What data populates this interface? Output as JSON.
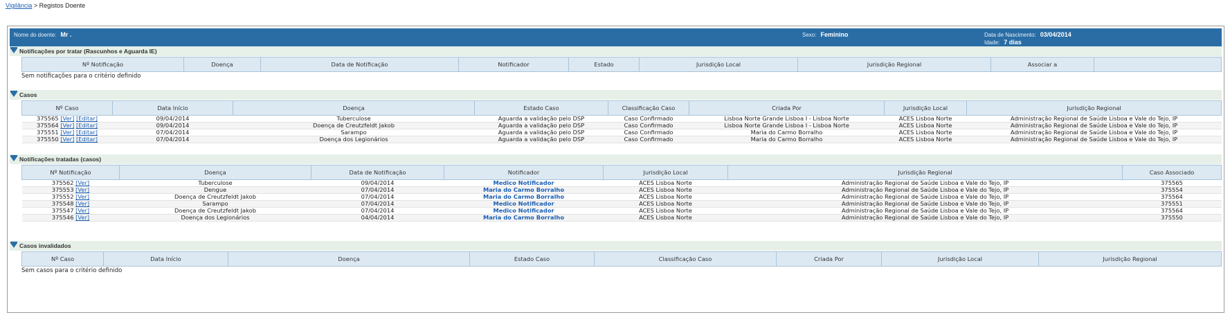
{
  "breadcrumb": {
    "link": "Vigilância",
    "sep": " > ",
    "current": "Registos Doente"
  },
  "patient": {
    "name_label": "Nome do doente:",
    "name": "Mr .",
    "sex_label": "Sexo:",
    "sex": "Feminino",
    "dob_label": "Data de Nascimento:",
    "dob": "03/04/2014",
    "age_label": "Idade:",
    "age": "7 dias"
  },
  "pending": {
    "title": "Notificações por tratar (Rascunhos e Aguarda IE)",
    "headers": [
      "Nº Notificação",
      "Doença",
      "Data de Notificação",
      "Notificador",
      "Estado",
      "Jurisdição Local",
      "Jurisdição Regional",
      "Associar a",
      ""
    ],
    "empty": "Sem notificações para o critério definido"
  },
  "cases": {
    "title": "Casos",
    "headers": [
      "Nº Caso",
      "Data Início",
      "Doença",
      "Estado Caso",
      "Classificação Caso",
      "Criada Por",
      "Jurisdição Local",
      "Jurisdição Regional"
    ],
    "ver": "[Ver]",
    "edit": "[Editar]",
    "rows": [
      [
        "375565",
        "09/04/2014",
        "Tuberculose",
        "Aguarda a validação pelo DSP",
        "Caso Confirmado",
        "Lisboa Norte Grande Lisboa I - Lisboa Norte",
        "ACES Lisboa Norte",
        "Administração Regional de Saúde Lisboa e Vale do Tejo, IP"
      ],
      [
        "375564",
        "09/04/2014",
        "Doença de Creutzfeldt Jakob",
        "Aguarda a validação pelo DSP",
        "Caso Confirmado",
        "Lisboa Norte Grande Lisboa I - Lisboa Norte",
        "ACES Lisboa Norte",
        "Administração Regional de Saúde Lisboa e Vale do Tejo, IP"
      ],
      [
        "375551",
        "07/04/2014",
        "Sarampo",
        "Aguarda a validação pelo DSP",
        "Caso Confirmado",
        "Maria do Carmo Borralho",
        "ACES Lisboa Norte",
        "Administração Regional de Saúde Lisboa e Vale do Tejo, IP"
      ],
      [
        "375550",
        "07/04/2014",
        "Doença dos Legionários",
        "Aguarda a validação pelo DSP",
        "Caso Confirmado",
        "Maria do Carmo Borralho",
        "ACES Lisboa Norte",
        "Administração Regional de Saúde Lisboa e Vale do Tejo, IP"
      ]
    ]
  },
  "treated": {
    "title": "Notificações tratadas (casos)",
    "headers": [
      "Nº Notificação",
      "Doença",
      "Data de Notificação",
      "Notificador",
      "Jurisdição Local",
      "Jurisdição Regional",
      "Caso Associado"
    ],
    "ver": "[Ver]",
    "rows": [
      [
        "375562",
        "Tuberculose",
        "09/04/2014",
        "Medico Notificador",
        "ACES Lisboa Norte",
        "Administração Regional de Saúde Lisboa e Vale do Tejo, IP",
        "375565"
      ],
      [
        "375553",
        "Dengue",
        "07/04/2014",
        "Maria do Carmo Borralho",
        "ACES Lisboa Norte",
        "Administração Regional de Saúde Lisboa e Vale do Tejo, IP",
        "375554"
      ],
      [
        "375552",
        "Doença de Creutzfeldt Jakob",
        "07/04/2014",
        "Maria do Carmo Borralho",
        "ACES Lisboa Norte",
        "Administração Regional de Saúde Lisboa e Vale do Tejo, IP",
        "375564"
      ],
      [
        "375548",
        "Sarampo",
        "07/04/2014",
        "Medico Notificador",
        "ACES Lisboa Norte",
        "Administração Regional de Saúde Lisboa e Vale do Tejo, IP",
        "375551"
      ],
      [
        "375547",
        "Doença de Creutzfeldt Jakob",
        "07/04/2014",
        "Medico Notificador",
        "ACES Lisboa Norte",
        "Administração Regional de Saúde Lisboa e Vale do Tejo, IP",
        "375564"
      ],
      [
        "375546",
        "Doença dos Legionários",
        "04/04/2014",
        "Maria do Carmo Borralho",
        "ACES Lisboa Norte",
        "Administração Regional de Saúde Lisboa e Vale do Tejo, IP",
        "375550"
      ]
    ]
  },
  "invalid": {
    "title": "Casos invalidados",
    "headers": [
      "Nº Caso",
      "Data Início",
      "Doença",
      "Estado Caso",
      "Classificação Caso",
      "Criada Por",
      "Jurisdição Local",
      "Jurisdição Regional"
    ],
    "empty": "Sem casos para o critério definido"
  }
}
